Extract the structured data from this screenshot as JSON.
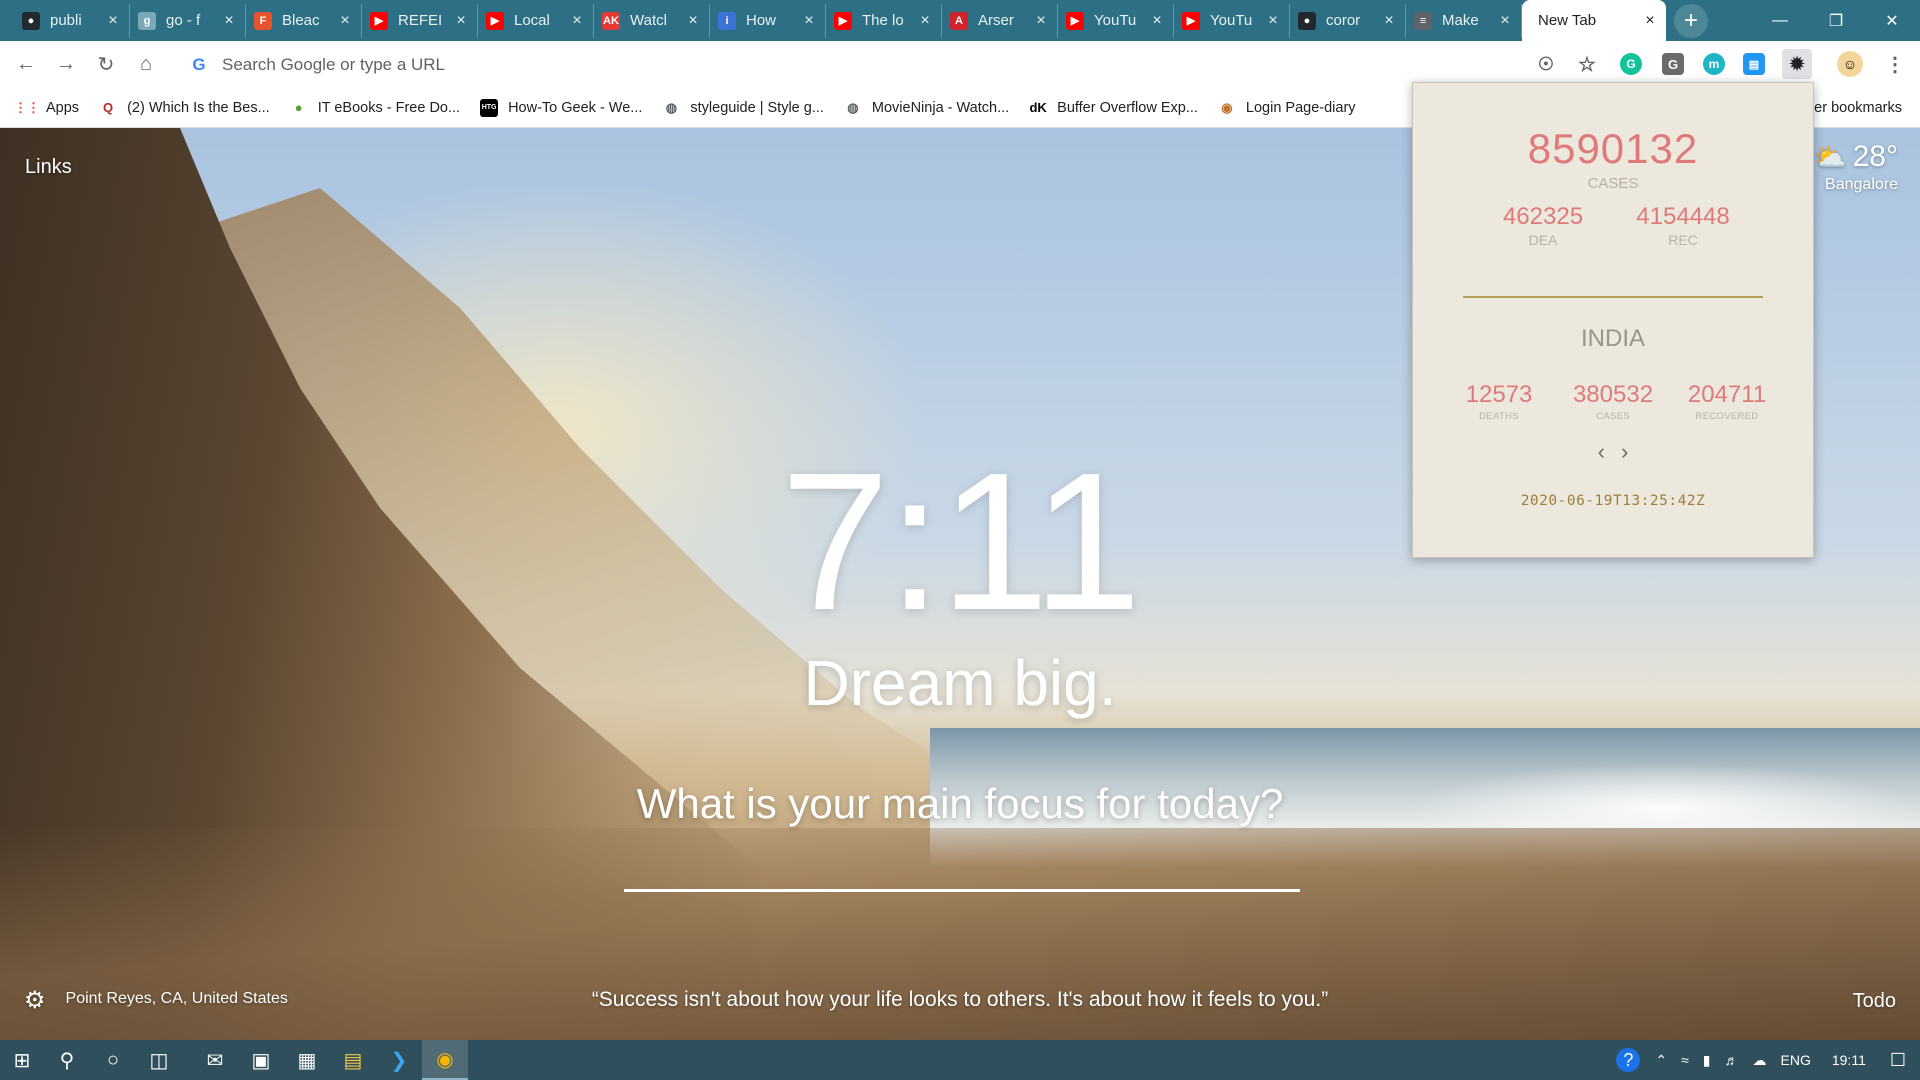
{
  "tabs": [
    {
      "title": "publi",
      "icon": "github-icon",
      "color": "#24292e"
    },
    {
      "title": "go - f",
      "icon": "gopher-icon",
      "color": "#7aa9b8"
    },
    {
      "title": "Bleac",
      "icon": "bleacher-icon",
      "color": "#e8522d"
    },
    {
      "title": "REFEI",
      "icon": "youtube-icon",
      "color": "#ff0000"
    },
    {
      "title": "Local",
      "icon": "youtube-icon",
      "color": "#ff0000"
    },
    {
      "title": "Watcl",
      "icon": "watch-icon",
      "color": "#e53935"
    },
    {
      "title": "How",
      "icon": "info-icon",
      "color": "#3b73d9"
    },
    {
      "title": "The lo",
      "icon": "youtube-icon",
      "color": "#ff0000"
    },
    {
      "title": "Arser",
      "icon": "arsenal-icon",
      "color": "#d2232a"
    },
    {
      "title": "YouTu",
      "icon": "youtube-icon",
      "color": "#ff0000"
    },
    {
      "title": "YouTu",
      "icon": "youtube-icon",
      "color": "#ff0000"
    },
    {
      "title": "coror",
      "icon": "github-icon",
      "color": "#24292e"
    },
    {
      "title": "Make",
      "icon": "document-icon",
      "color": "#5f6368"
    }
  ],
  "active_tab": {
    "title": "New Tab"
  },
  "omnibox": {
    "placeholder": "Search Google or type a URL"
  },
  "bookmarks": [
    {
      "label": "Apps",
      "icon": "apps-grid-icon",
      "color": "#ea4335"
    },
    {
      "label": "(2) Which Is the Bes...",
      "icon": "quora-icon",
      "color": "#b92b27"
    },
    {
      "label": "IT eBooks - Free Do...",
      "icon": "ebook-icon",
      "color": "#5aa02c"
    },
    {
      "label": "How-To Geek - We...",
      "icon": "htg-icon",
      "color": "#000000"
    },
    {
      "label": "styleguide | Style g...",
      "icon": "globe-icon",
      "color": "#5f6368"
    },
    {
      "label": "MovieNinja - Watch...",
      "icon": "globe-icon",
      "color": "#5f6368"
    },
    {
      "label": "Buffer Overflow Exp...",
      "icon": "dk-icon",
      "color": "#000000"
    },
    {
      "label": "Login Page-diary",
      "icon": "diary-icon",
      "color": "#c0752e"
    }
  ],
  "other_bookmarks": "er bookmarks",
  "momentum": {
    "links": "Links",
    "weather": {
      "temp": "28°",
      "location": "Bangalore"
    },
    "clock": "7:11",
    "mantra": "Dream big.",
    "focus_question": "What is your main focus for today?",
    "photo_location": "Point Reyes, CA, United States",
    "quote": "“Success isn't about how your life looks to others. It's about how it feels to you.”",
    "todo": "Todo"
  },
  "covid": {
    "global_cases": "8590132",
    "global_cases_label": "CASES",
    "global_deaths": "462325",
    "global_deaths_label": "DEA",
    "global_recovered": "4154448",
    "global_recovered_label": "REC",
    "country": "INDIA",
    "country_deaths": "12573",
    "country_deaths_label": "DEATHS",
    "country_cases": "380532",
    "country_cases_label": "CASES",
    "country_recovered": "204711",
    "country_recovered_label": "RECOVERED",
    "timestamp": "2020-06-19T13:25:42Z"
  },
  "taskbar": {
    "language": "ENG",
    "time": "19:11"
  }
}
